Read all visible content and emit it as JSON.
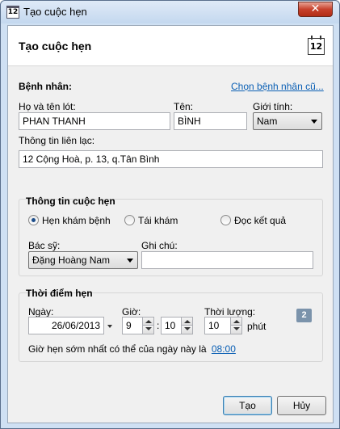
{
  "window": {
    "title": "Tạo cuộc hẹn",
    "app_icon_text": "12",
    "close_symbol": "✕"
  },
  "header": {
    "title": "Tạo cuộc hẹn",
    "calendar_icon_text": "12"
  },
  "patient": {
    "section_label": "Bệnh nhân:",
    "choose_link": "Chọn bệnh nhân cũ...",
    "surname_label": "Họ và tên lót:",
    "surname_value": "PHAN THANH",
    "name_label": "Tên:",
    "name_value": "BÌNH",
    "gender_label": "Giới tính:",
    "gender_value": "Nam",
    "contact_label": "Thông tin liên lạc:",
    "contact_value": "12 Cộng Hoà, p. 13, q.Tân Bình"
  },
  "appointment_info": {
    "title": "Thông tin cuộc hẹn",
    "options": [
      "Hẹn khám bệnh",
      "Tái khám",
      "Đọc kết quả"
    ],
    "selected_option": "Hẹn khám bệnh",
    "doctor_label": "Bác sỹ:",
    "doctor_value": "Đặng Hoàng Nam",
    "note_label": "Ghi chú:",
    "note_value": ""
  },
  "appointment_time": {
    "title": "Thời điểm hẹn",
    "date_label": "Ngày:",
    "date_value": "26/06/2013",
    "hour_label": "Giờ:",
    "hour_value": "9",
    "minute_value": "10",
    "time_separator": ":",
    "duration_label": "Thời lượng:",
    "duration_value": "10",
    "duration_unit": "phút",
    "badge": "2",
    "earliest_text": "Giờ hẹn sớm nhất có thể của ngày này là",
    "earliest_time": "08:00"
  },
  "buttons": {
    "create": "Tạo",
    "cancel": "Hủy"
  },
  "colors": {
    "link": "#0a5fb4",
    "badge": "#7b93ab",
    "close": "#c7412c"
  }
}
